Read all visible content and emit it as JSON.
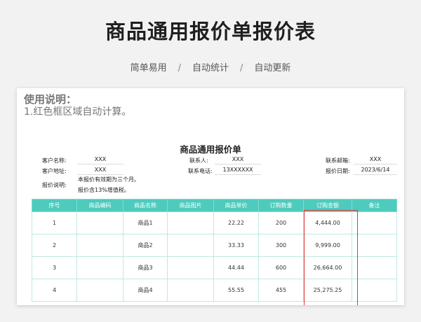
{
  "hero": {
    "title": "商品通用报价单报价表",
    "tags": [
      "简单易用",
      "自动统计",
      "自动更新"
    ],
    "separator": "/"
  },
  "notes": {
    "title": "使用说明：",
    "body": "1.红色框区域自动计算。"
  },
  "form": {
    "title": "商品通用报价单",
    "customer_name_label": "客户名称:",
    "customer_name": "XXX",
    "contact_label": "联系人:",
    "contact": "XXX",
    "email_label": "联系邮箱:",
    "email": "XXX",
    "address_label": "客户地址:",
    "address": "XXX",
    "phone_label": "联系电话:",
    "phone": "13XXXXXX",
    "date_label": "报价日期:",
    "date": "2023/6/14",
    "quote_note_label": "报价说明:",
    "quote_note_1": "本报价有效期为三个月。",
    "quote_note_2": "报价含13%增值税。"
  },
  "table": {
    "headers": [
      "序号",
      "商品编码",
      "商品名称",
      "商品图片",
      "商品单价",
      "订购数量",
      "订购金额",
      "备注"
    ],
    "rows": [
      {
        "no": "1",
        "code": "",
        "name": "商品1",
        "image": "",
        "price": "22.22",
        "qty": "200",
        "amount": "4,444.00",
        "remark": ""
      },
      {
        "no": "2",
        "code": "",
        "name": "商品2",
        "image": "",
        "price": "33.33",
        "qty": "300",
        "amount": "9,999.00",
        "remark": ""
      },
      {
        "no": "3",
        "code": "",
        "name": "商品3",
        "image": "",
        "price": "44.44",
        "qty": "600",
        "amount": "26,664.00",
        "remark": ""
      },
      {
        "no": "4",
        "code": "",
        "name": "商品4",
        "image": "",
        "price": "55.55",
        "qty": "455",
        "amount": "25,275.25",
        "remark": ""
      }
    ]
  },
  "colors": {
    "header_teal": "#4ecbbd",
    "auto_calc_border": "#d93a3a"
  }
}
